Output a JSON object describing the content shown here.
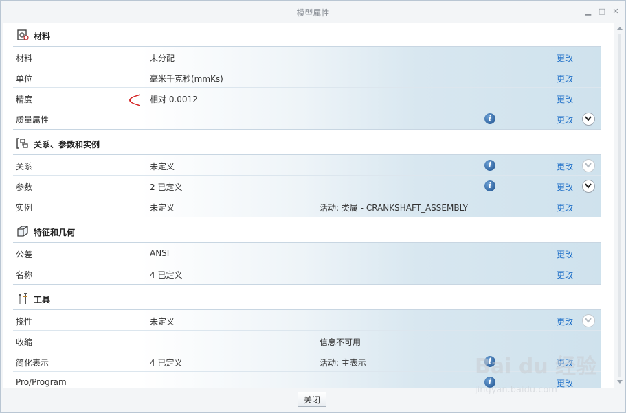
{
  "window": {
    "title": "模型属性",
    "minimize": "▁",
    "maximize": "□",
    "close": "✕"
  },
  "sections": [
    {
      "title": "材料",
      "icon": "material-icon",
      "rows": [
        {
          "label": "材料",
          "value": "未分配",
          "extra": "",
          "info": false,
          "link": "更改",
          "expand": "none"
        },
        {
          "label": "单位",
          "value": "毫米千克秒(mmKs)",
          "extra": "",
          "info": false,
          "link": "更改",
          "expand": "none"
        },
        {
          "label": "精度",
          "value": "相对 0.0012",
          "extra": "",
          "info": false,
          "link": "更改",
          "expand": "none"
        },
        {
          "label": "质量属性",
          "value": "",
          "extra": "",
          "info": true,
          "link": "更改",
          "expand": "active"
        }
      ]
    },
    {
      "title": "关系、参数和实例",
      "icon": "relations-icon",
      "rows": [
        {
          "label": "关系",
          "value": "未定义",
          "extra": "",
          "info": true,
          "link": "更改",
          "expand": "dim"
        },
        {
          "label": "参数",
          "value": "2 已定义",
          "extra": "",
          "info": true,
          "link": "更改",
          "expand": "active"
        },
        {
          "label": "实例",
          "value": "未定义",
          "extra": "活动: 类属 - CRANKSHAFT_ASSEMBLY",
          "info": false,
          "link": "更改",
          "expand": "none"
        }
      ]
    },
    {
      "title": "特征和几何",
      "icon": "feature-geometry-icon",
      "rows": [
        {
          "label": "公差",
          "value": "ANSI",
          "extra": "",
          "info": false,
          "link": "更改",
          "expand": "none"
        },
        {
          "label": "名称",
          "value": "4 已定义",
          "extra": "",
          "info": false,
          "link": "更改",
          "expand": "none"
        }
      ]
    },
    {
      "title": "工具",
      "icon": "tools-icon",
      "rows": [
        {
          "label": "挠性",
          "value": "未定义",
          "extra": "",
          "info": false,
          "link": "更改",
          "expand": "dim"
        },
        {
          "label": "收缩",
          "value": "",
          "extra": "信息不可用",
          "info": false,
          "link": "",
          "expand": "none"
        },
        {
          "label": "简化表示",
          "value": "4 已定义",
          "extra": "活动: 主表示",
          "info": true,
          "link": "更改",
          "expand": "none"
        },
        {
          "label": "Pro/Program",
          "value": "",
          "extra": "",
          "info": true,
          "link": "更改",
          "expand": "none"
        }
      ]
    }
  ],
  "footer": {
    "close_label": "关闭"
  },
  "watermark": {
    "main": "Bai du 经验",
    "sub": "jingyan.baidu.com"
  },
  "colors": {
    "link": "#1e6fc8",
    "annotation": "#d42020",
    "band": "#cfe2ed"
  }
}
